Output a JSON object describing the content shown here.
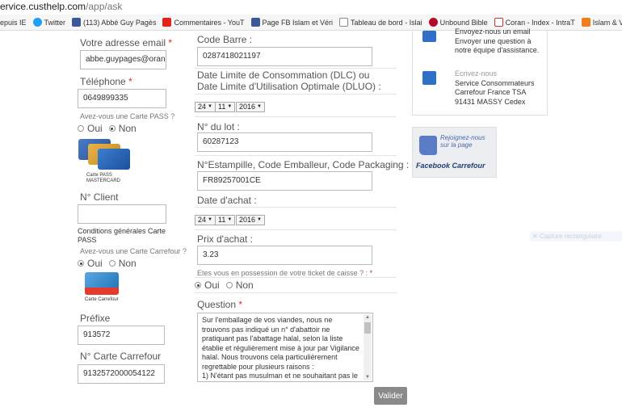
{
  "browser": {
    "url_domain": "ervice.custhelp.com",
    "url_path": "/app/ask",
    "bookmarks": [
      {
        "label": "epuis IE",
        "icon": "none"
      },
      {
        "label": "Twitter",
        "icon": "twitter-icon"
      },
      {
        "label": "(113) Abbé Guy Pagès",
        "icon": "facebook-icon"
      },
      {
        "label": "Commentaires - YouT",
        "icon": "youtube-icon"
      },
      {
        "label": "Page FB Islam et Véri",
        "icon": "facebook-icon"
      },
      {
        "label": "Tableau de bord - Islai",
        "icon": "document-icon"
      },
      {
        "label": "Unbound Bible",
        "icon": "unbound-icon"
      },
      {
        "label": "Coran - Index - IntraT",
        "icon": "coran-icon"
      },
      {
        "label": "Islam & Vérité",
        "icon": "islam-icon"
      }
    ]
  },
  "left": {
    "email_label": "Votre adresse email",
    "email_value": "abbe.guypages@orange",
    "phone_label": "Téléphone",
    "phone_value": "0649899335",
    "pass_question": "Avez-vous une Carte PASS ?",
    "oui": "Oui",
    "non": "Non",
    "pass_card_caption": "Carte PASS MASTERCARD",
    "client_label": "N° Client",
    "client_value": "",
    "conditions_text": "Conditions générales Carte PASS",
    "carrefour_question": "Avez-vous une Carte Carrefour ?",
    "carrefour_card_caption": "Carte Carrefour",
    "prefix_label": "Préfixe",
    "prefix_value": "913572",
    "carrefour_number_label": "N° Carte Carrefour",
    "carrefour_number_value": "9132572000054122"
  },
  "middle": {
    "barcode_label": "Code Barre :",
    "barcode_value": "0287418021197",
    "dlc_label": "Date Limite de Consommation (DLC) ou Date Limite d'Utilisation Optimale (DLUO) :",
    "dlc_day": "24",
    "dlc_month": "11",
    "dlc_year": "2016",
    "lot_label": "N° du lot :",
    "lot_value": "60287123",
    "stamp_label": "N°Estampille, Code Emballeur, Code Packaging :",
    "stamp_value": "FR89257001CE",
    "purchase_date_label": "Date d'achat :",
    "purchase_day": "24",
    "purchase_month": "11",
    "purchase_year": "2016",
    "price_label": "Prix d'achat :",
    "price_value": "3.23",
    "receipt_question": "Etes vous en possession de votre ticket de caisse ? :",
    "question_label": "Question",
    "question_text": "Sur l'emballage de vos viandes, nous ne trouvons pas indiqué un n° d'abattoir ne pratiquant pas l'abattage halal, selon la liste établie et régulièrement mise à jour par Vigilance halal. Nous trouvons cela particulièrement regrettable pour plusieurs raisons :\n1) N'étant pas musulman et ne souhaitant pas le",
    "submit_label": "Valider"
  },
  "right": {
    "email_block": "Envoyez-nous un email Envoyer une question à notre équipe d'assistance.",
    "mail_title": "Ecrivez-nous",
    "mail_line1": "Service Consommateurs",
    "mail_line2": "Carrefour France TSA",
    "mail_line3": "91431 MASSY Cedex",
    "fb_line1": "Rejoignez-nous sur la page",
    "fb_line2": "Facebook Carrefour",
    "ghost_label": "Capture rectangulaire"
  }
}
